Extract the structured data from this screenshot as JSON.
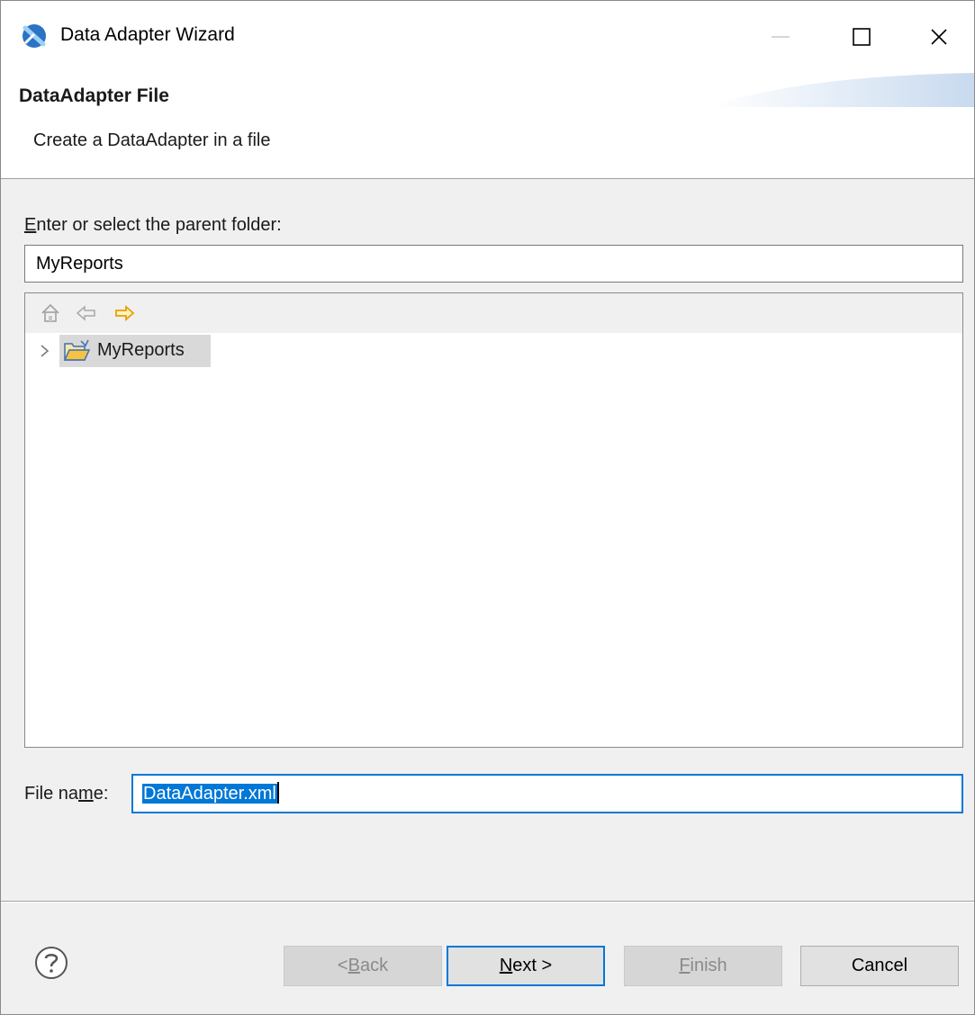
{
  "window": {
    "title": "Data Adapter Wizard"
  },
  "banner": {
    "title": "DataAdapter File",
    "description": "Create a DataAdapter in a file"
  },
  "folder": {
    "label_accel": "E",
    "label_rest": "nter or select the parent folder:",
    "value": "MyReports"
  },
  "tree": {
    "toolbar": [
      "home-icon",
      "back-arrow-icon",
      "forward-arrow-icon"
    ],
    "items": [
      {
        "label": "MyReports",
        "expanded": false,
        "selected": true,
        "icon": "open-folder-icon"
      }
    ]
  },
  "filename": {
    "label_pre": "File na",
    "label_accel": "m",
    "label_post": "e:",
    "value": "DataAdapter.xml"
  },
  "buttons": {
    "back_pre": "< ",
    "back_accel": "B",
    "back_post": "ack",
    "next_accel": "N",
    "next_post": "ext >",
    "finish_accel": "F",
    "finish_post": "inish",
    "cancel": "Cancel"
  },
  "colors": {
    "accent": "#0078d7",
    "forward_arrow": "#e8a000",
    "folder": "#f5c342"
  }
}
